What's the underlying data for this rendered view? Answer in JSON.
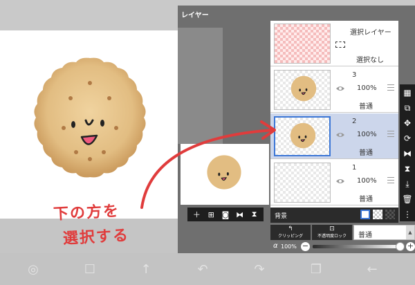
{
  "layer_panel": {
    "title": "レイヤー",
    "selection_layer": {
      "title": "選択レイヤー",
      "status": "選択なし"
    },
    "layers": [
      {
        "number": "3",
        "opacity": "100%",
        "blend": "普通",
        "selected": false,
        "has_cookie": true
      },
      {
        "number": "2",
        "opacity": "100%",
        "blend": "普通",
        "selected": true,
        "has_cookie": true
      },
      {
        "number": "1",
        "opacity": "100%",
        "blend": "普通",
        "selected": false,
        "has_cookie": false
      }
    ],
    "background_label": "背景",
    "clipping_label": "クリッピング",
    "alpha_lock_label": "不透明度ロック",
    "blend_mode_value": "普通",
    "alpha_symbol": "α",
    "alpha_value": "100%",
    "minus_symbol": "−",
    "plus_symbol": "+",
    "preview_toolbar_icons": [
      "plus-icon",
      "add-layer-icon",
      "camera-icon",
      "flip-horizontal-icon",
      "flip-vertical-icon"
    ]
  },
  "right_toolbar_icons": [
    "checker-icon",
    "transfer-icon",
    "move-icon",
    "rotate-icon",
    "flip-horizontal-icon",
    "flip-vertical-icon",
    "merge-down-icon",
    "trash-icon",
    "more-icon"
  ],
  "annotation": {
    "line1": "下の方を",
    "line2": "選択する",
    "color": "#e03c3c"
  },
  "nav_bar_icons": [
    "circle-icon",
    "square-icon",
    "arrow-up-icon",
    "undo-icon",
    "redo-icon",
    "layers-icon",
    "back-icon"
  ],
  "colors": {
    "selected_row": "#ccd6eb",
    "selected_border": "#3b76d6",
    "panel_bg": "#6f6f6f",
    "cookie": "#e7c58e"
  }
}
